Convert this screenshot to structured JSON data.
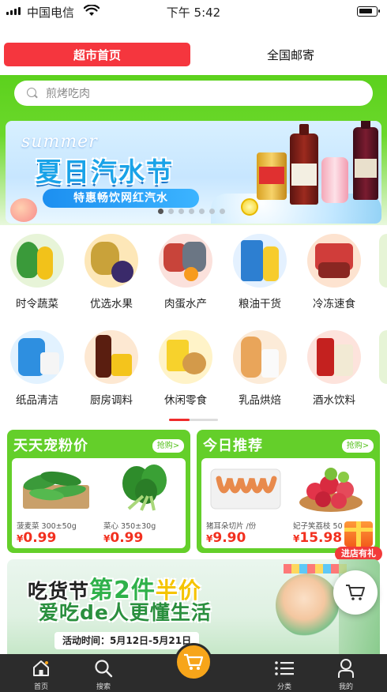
{
  "status_bar": {
    "carrier": "中国电信",
    "time": "下午 5:42"
  },
  "top_tabs": [
    {
      "label": "超市首页",
      "active": true
    },
    {
      "label": "全国邮寄",
      "active": false
    }
  ],
  "search": {
    "placeholder": "煎烤吃肉"
  },
  "banner": {
    "script_text": "summer",
    "title": "夏日汽水节",
    "subtitle": "特惠畅饮网红汽水",
    "page_count": 7,
    "active_page": 1
  },
  "categories": [
    {
      "label": "时令蔬菜",
      "icon": "vegetables"
    },
    {
      "label": "优选水果",
      "icon": "fruits"
    },
    {
      "label": "肉蛋水产",
      "icon": "meat-seafood"
    },
    {
      "label": "粮油干货",
      "icon": "grain-oil"
    },
    {
      "label": "冷冻速食",
      "icon": "frozen-food"
    },
    {
      "label": "纸品清洁",
      "icon": "paper-cleaning"
    },
    {
      "label": "厨房调料",
      "icon": "seasoning"
    },
    {
      "label": "休闲零食",
      "icon": "snacks"
    },
    {
      "label": "乳品烘焙",
      "icon": "dairy-bakery"
    },
    {
      "label": "酒水饮料",
      "icon": "drinks"
    }
  ],
  "promo_cards": [
    {
      "title": "天天宠粉价",
      "action": "抢购>",
      "products": [
        {
          "name": "菠麦菜 300±50g",
          "currency": "¥",
          "price": "0.99"
        },
        {
          "name": "菜心 350±30g",
          "currency": "¥",
          "price": "0.99"
        }
      ]
    },
    {
      "title": "今日推荐",
      "action": "抢购>",
      "products": [
        {
          "name": "猪耳朵切片 /份",
          "currency": "¥",
          "price": "9.90"
        },
        {
          "name": "妃子笑荔枝 50",
          "currency": "¥",
          "price": "15.98"
        }
      ]
    }
  ],
  "gift_badge": {
    "label": "进店有礼"
  },
  "bottom_banner": {
    "line1_a": "吃货节",
    "line1_b": "第",
    "line1_c": "2",
    "line1_d": "件",
    "line1_e": "半价",
    "line2": "爱吃de人更懂生活",
    "date": "活动时间：5月12日-5月21日"
  },
  "bottom_nav": [
    {
      "label": "首页",
      "icon": "home-icon"
    },
    {
      "label": "搜索",
      "icon": "search-icon"
    },
    {
      "label": "",
      "icon": "cart-icon"
    },
    {
      "label": "分类",
      "icon": "category-icon"
    },
    {
      "label": "我的",
      "icon": "profile-icon"
    }
  ],
  "colors": {
    "brand_green": "#64cf2a",
    "tab_red": "#f5363e",
    "price_red": "#f2301f",
    "nav_bg": "#2c2c2c",
    "cart_orange": "#f7a51a"
  }
}
